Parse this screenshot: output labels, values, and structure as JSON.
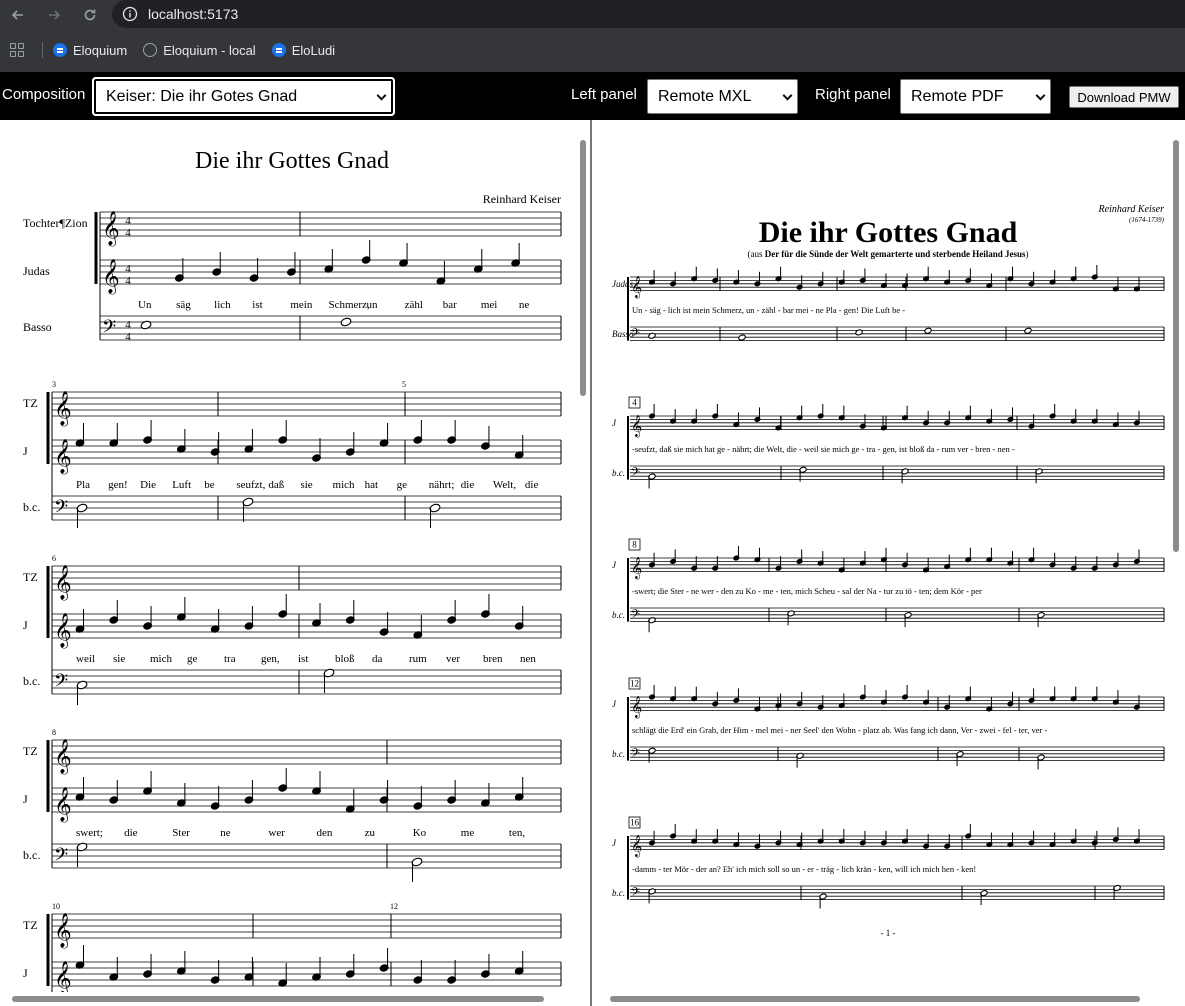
{
  "browser": {
    "url": "localhost:5173",
    "bookmarks": [
      {
        "label": "Eloquium",
        "icon": "eloquium-icon"
      },
      {
        "label": "Eloquium - local",
        "icon": "globe-icon"
      },
      {
        "label": "EloLudi",
        "icon": "eloludi-icon"
      }
    ]
  },
  "toolbar": {
    "composition_label": "Composition",
    "composition_value": "Keiser: Die ihr Gotes Gnad",
    "left_panel_label": "Left panel",
    "left_panel_value": "Remote MXL",
    "right_panel_label": "Right panel",
    "right_panel_value": "Remote PDF",
    "download_label": "Download PMW"
  },
  "left_score": {
    "title": "Die ihr Gottes Gnad",
    "composer": "Reinhard Keiser",
    "parts_first": [
      "Tochter¶Zion",
      "Judas",
      "Basso"
    ],
    "parts_abbrev": [
      "TZ",
      "J",
      "b.c."
    ],
    "measure_numbers": [
      "3",
      "5",
      "6",
      "8",
      "10",
      "12"
    ],
    "lyrics": [
      [
        "Un",
        "-",
        "säg",
        "-",
        "lich",
        "ist",
        "mein",
        "Schmerz,",
        "un",
        "-",
        "zähl",
        "-",
        "bar",
        "mei",
        "-",
        "ne"
      ],
      [
        "Pla",
        "-",
        "gen!",
        "Die",
        "Luft",
        "be",
        "-",
        "seufzt,",
        "daß",
        "sie",
        "mich",
        "hat",
        "ge",
        "-",
        "nährt;",
        "die",
        "Welt,",
        "die",
        "-"
      ],
      [
        "weil",
        "sie",
        "mich",
        "ge",
        "-",
        "tra",
        "-",
        "gen,",
        "ist",
        "bloß",
        "da",
        "-",
        "rum",
        "ver",
        "-",
        "bren",
        "-",
        "nen",
        "-"
      ],
      [
        "swert;",
        "die",
        "Ster",
        "-",
        "ne",
        "wer",
        "-",
        "den",
        "zu",
        "Ko",
        "-",
        "me",
        "-",
        "ten,"
      ]
    ]
  },
  "right_score": {
    "title": "Die ihr Gottes Gnad",
    "subtitle_prefix": "(aus ",
    "subtitle_bold": "Der für die Sünde der Welt gemarterte und sterbende Heiland Jesus",
    "subtitle_suffix": ")",
    "composer": "Reinhard Keiser",
    "dates": "(1674-1739)",
    "parts_first": [
      "Judas",
      "Basso"
    ],
    "parts_abbrev": [
      "J",
      "b.c."
    ],
    "system_numbers": [
      "4",
      "8",
      "12",
      "16"
    ],
    "lyrics": [
      "Un - säg - lich  ist  mein Schmerz,     un - zähl - bar  mei - ne     Pla - gen!     Die Luft  be -",
      "-seufzt,   daß sie mich hat ge - nährt;   die Welt,  die - weil sie mich ge - tra - gen,     ist bloß da - rum ver - bren - nen -",
      "-swert;      die Ster - ne    wer - den zu  Ko - me - ten,    mich Scheu - sal der Na - tur  zu    tö - ten;    dem Kör - per",
      "schlägt die Erd' ein Grab,   der Him - mel mei - ner Seel' den Wohn - platz ab.    Was fang ich dann, Ver - zwei - fel - ter,  ver -",
      "-damm - ter Mör - der an?    Eh'    ich mich soll so  un - er - träg - lich    krän - ken,    will ich mich    hen - ken!"
    ],
    "page_number": "- 1 -"
  },
  "colors": {
    "chrome_bg": "#35363a",
    "url_bg": "#202124",
    "toolbar_bg": "#000000",
    "bookmark_icon": "#1a73e8"
  }
}
